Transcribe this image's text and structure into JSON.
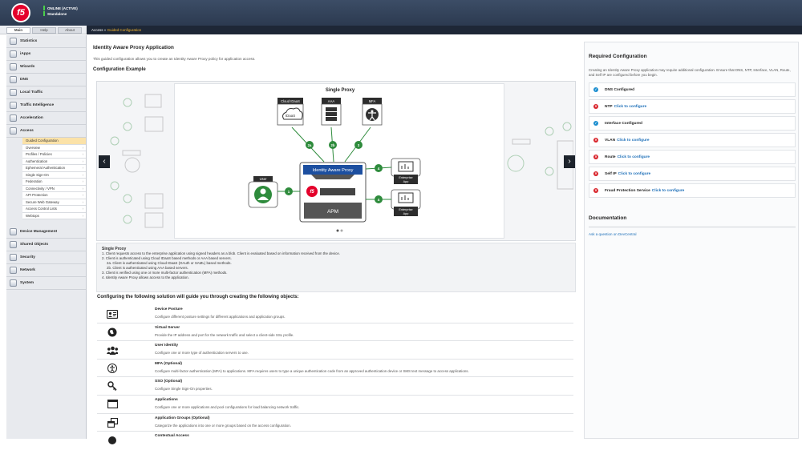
{
  "header": {
    "logo_text": "f5",
    "status_line1": "ONLINE (ACTIVE)",
    "status_line2": "Standalone"
  },
  "tabs": [
    "Main",
    "Help",
    "About"
  ],
  "breadcrumb": {
    "section": "Access",
    "separator": "»",
    "current": "Guided Configuration"
  },
  "sidebar": {
    "top_items": [
      "Statistics",
      "iApps",
      "Wizards",
      "DNS",
      "Local Traffic",
      "Traffic Intelligence",
      "Acceleration"
    ],
    "access_label": "Access",
    "access_items": [
      "Guided Configuration",
      "Overview",
      "Profiles / Policies",
      "Authentication",
      "Ephemeral Authentication",
      "Single Sign-On",
      "Federation",
      "Connectivity / VPN",
      "API Protection",
      "Secure Web Gateway",
      "Access Control Lists",
      "Webtops"
    ],
    "bottom_items": [
      "Device Management",
      "Shared Objects",
      "Security",
      "Network",
      "System"
    ]
  },
  "main": {
    "title": "Identity Aware Proxy Application",
    "description": "This guided configuration allows you to create an Identity Aware Proxy policy for application access.",
    "example_heading": "Configuration Example",
    "diagram": {
      "title": "Single Proxy",
      "cloud_idaas": "Cloud IDaaS",
      "idaas": "IDaaS",
      "aaa": "AAA",
      "mfa": "MFA",
      "user": "User",
      "iap": "Identity Aware Proxy",
      "apm": "APM",
      "enterprise_app": "Enterprise",
      "enterprise_app2": "App",
      "step1": "1",
      "step2a": "2a",
      "step2b": "2b",
      "step3": "3",
      "step4": "4"
    },
    "notes": {
      "title": "Single Proxy",
      "lines": [
        "1. Client requests access to the enterprise application using signed headers as a blob. Client is evaluated based on information received from the device.",
        "2. Client is authenticated using Cloud IDaaS based methods or AAA based servers.",
        "2a. Client is authenticated using Cloud IDaaS (OAuth or SAML) based methods.",
        "2b. Client is authenticated using AAA based servers.",
        "3. Client is verified using one or more multi-factor authentication (MFA) methods.",
        "4. Identity Aware Proxy allows access to the application."
      ]
    },
    "objects_heading": "Configuring the following solution will guide you through creating the following objects:",
    "objects": [
      {
        "name": "Device Posture",
        "desc": "Configure different posture settings for different applications and application groups.",
        "icon": "id-card-icon"
      },
      {
        "name": "Virtual Server",
        "desc": "Provide the IP address and port for the network traffic and select a client-side SSL profile.",
        "icon": "globe-icon"
      },
      {
        "name": "User Identity",
        "desc": "Configure one or more type of authentication servers to use.",
        "icon": "users-icon"
      },
      {
        "name": "MFA (Optional)",
        "desc": "Configure multi-factor authentication (MFA) to applications. MFA requires users to type a unique authentication code from an approved authentication device or SMS text message to access applications.",
        "icon": "accessibility-icon"
      },
      {
        "name": "SSO (Optional)",
        "desc": "Configure Single Sign-On properties.",
        "icon": "key-icon"
      },
      {
        "name": "Applications",
        "desc": "Configure one or more applications and pool configurations for load balancing network traffic.",
        "icon": "window-icon"
      },
      {
        "name": "Application Groups (Optional)",
        "desc": "Categorize the applications into one or more groups based on the access configuration.",
        "icon": "app-group-icon"
      },
      {
        "name": "Contextual Access",
        "desc": "",
        "icon": "context-icon"
      }
    ]
  },
  "right": {
    "title": "Required Configuration",
    "description": "Creating an Identity Aware Proxy application may require additional configuration. Ensure that DNS, NTP, Interface, VLAN, Route, and Self IP are configured before you begin.",
    "items": [
      {
        "label": "DNS Configured",
        "status": "ok",
        "link": ""
      },
      {
        "label": "NTP",
        "status": "bad",
        "link": "Click to configure"
      },
      {
        "label": "Interface Configured",
        "status": "ok",
        "link": ""
      },
      {
        "label": "VLAN",
        "status": "bad",
        "link": "Click to configure"
      },
      {
        "label": "Route",
        "status": "bad",
        "link": "Click to configure"
      },
      {
        "label": "Self IP",
        "status": "bad",
        "link": "Click to configure"
      },
      {
        "label": "Fraud Protection Service",
        "status": "bad",
        "link": "Click to configure"
      }
    ],
    "doc_title": "Documentation",
    "doc_link": "Ask a question on DevCentral"
  },
  "colors": {
    "brand": "#e4002b",
    "step_green": "#2e8b3c",
    "iap_blue": "#1c4fa0",
    "ok_blue": "#1e8fd0",
    "bad_red": "#d8232a",
    "link": "#1d6fb8"
  }
}
